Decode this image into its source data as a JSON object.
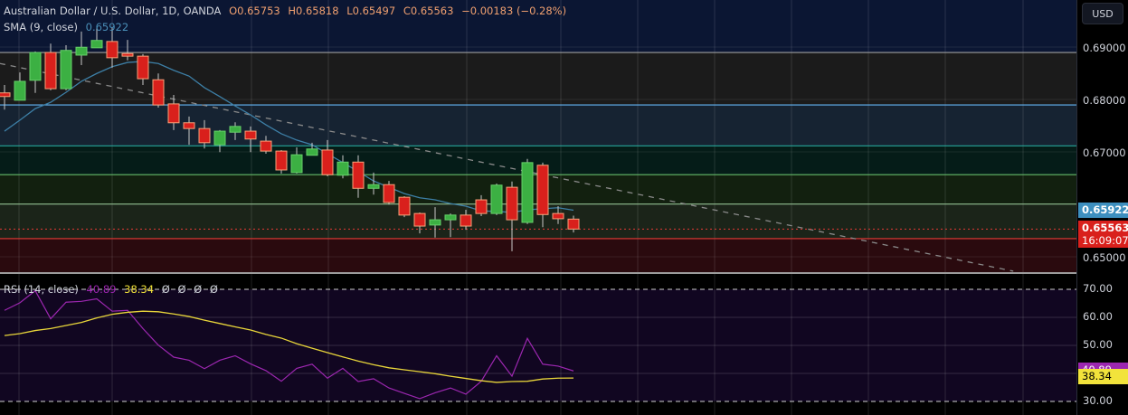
{
  "header": {
    "symbol_title": "Australian Dollar / U.S. Dollar, 1D, OANDA",
    "open": "O0.65753",
    "high": "H0.65818",
    "low": "L0.65497",
    "close": "C0.65563",
    "change": "−0.00183 (−0.28%)",
    "sma_label": "SMA (9, close)",
    "sma_value": "0.65922",
    "rsi_label": "RSI (14, close)",
    "rsi_value": "40.89",
    "rsi_ma_value": "38.34",
    "rsi_empty": [
      "Ø",
      "Ø",
      "Ø",
      "Ø"
    ]
  },
  "price_axis": {
    "currency_button": "USD",
    "ticks": [
      {
        "label": "0.69000",
        "v": 0.69
      },
      {
        "label": "0.68000",
        "v": 0.68
      },
      {
        "label": "0.67000",
        "v": 0.67
      },
      {
        "label": "0.65000",
        "v": 0.65
      }
    ],
    "sma_badge": {
      "label": "0.65922",
      "v": 0.65922
    },
    "price_badge": {
      "label": "0.65563",
      "countdown": "16:09:07",
      "v": 0.65563
    }
  },
  "rsi_axis": {
    "ticks": [
      {
        "label": "70.00",
        "v": 70
      },
      {
        "label": "60.00",
        "v": 60
      },
      {
        "label": "50.00",
        "v": 50
      },
      {
        "label": "30.00",
        "v": 30
      }
    ],
    "rsi_badge": {
      "label": "40.89",
      "v": 40.89
    },
    "ma_badge": {
      "label": "38.34",
      "v": 38.34
    }
  },
  "colors": {
    "up": "#3cb043",
    "down": "#d9201c",
    "down_border": "#f7a27a",
    "up_border": "#66d06a",
    "sma": "#3d7fa6",
    "rsi": "#9c27b0",
    "rsi_ma": "#f2e33b",
    "sma_badge": "#3d8fbf",
    "price_badge": "#d9201c"
  },
  "chart_data": {
    "type": "candlestick",
    "candles": [
      [
        0.6816,
        0.6831,
        0.6784,
        0.6809
      ],
      [
        0.6802,
        0.6855,
        0.6802,
        0.6838
      ],
      [
        0.684,
        0.6895,
        0.6816,
        0.6893
      ],
      [
        0.6893,
        0.691,
        0.6821,
        0.6824
      ],
      [
        0.6824,
        0.6907,
        0.6821,
        0.6897
      ],
      [
        0.6888,
        0.6933,
        0.6869,
        0.6903
      ],
      [
        0.6902,
        0.6941,
        0.6902,
        0.6916
      ],
      [
        0.6914,
        0.6941,
        0.6864,
        0.6883
      ],
      [
        0.6891,
        0.6917,
        0.6878,
        0.6886
      ],
      [
        0.6886,
        0.689,
        0.6831,
        0.6843
      ],
      [
        0.6841,
        0.6853,
        0.6788,
        0.6793
      ],
      [
        0.6795,
        0.6812,
        0.6745,
        0.6759
      ],
      [
        0.6759,
        0.6771,
        0.6717,
        0.6748
      ],
      [
        0.6748,
        0.6764,
        0.671,
        0.6721
      ],
      [
        0.6717,
        0.6745,
        0.6703,
        0.6743
      ],
      [
        0.6741,
        0.676,
        0.6726,
        0.6752
      ],
      [
        0.6743,
        0.6752,
        0.6703,
        0.6728
      ],
      [
        0.6724,
        0.6734,
        0.67,
        0.6705
      ],
      [
        0.6705,
        0.6707,
        0.6662,
        0.6669
      ],
      [
        0.6664,
        0.6712,
        0.6662,
        0.6698
      ],
      [
        0.6697,
        0.6721,
        0.6697,
        0.6709
      ],
      [
        0.6707,
        0.6726,
        0.6657,
        0.666
      ],
      [
        0.6659,
        0.6697,
        0.6653,
        0.6684
      ],
      [
        0.6684,
        0.6697,
        0.6616,
        0.6634
      ],
      [
        0.6634,
        0.6664,
        0.6622,
        0.6641
      ],
      [
        0.6641,
        0.6648,
        0.6603,
        0.6607
      ],
      [
        0.6617,
        0.6619,
        0.6579,
        0.6583
      ],
      [
        0.6586,
        0.6588,
        0.6548,
        0.6562
      ],
      [
        0.6564,
        0.6598,
        0.654,
        0.6574
      ],
      [
        0.6574,
        0.6586,
        0.6541,
        0.6583
      ],
      [
        0.6583,
        0.6593,
        0.6555,
        0.6562
      ],
      [
        0.6612,
        0.6621,
        0.6581,
        0.6586
      ],
      [
        0.6586,
        0.6643,
        0.6583,
        0.664
      ],
      [
        0.6636,
        0.6647,
        0.6514,
        0.6574
      ],
      [
        0.6569,
        0.669,
        0.6566,
        0.6683
      ],
      [
        0.6678,
        0.6683,
        0.656,
        0.6584
      ],
      [
        0.6586,
        0.66,
        0.6566,
        0.6576
      ],
      [
        0.65753,
        0.65818,
        0.65497,
        0.65563
      ]
    ],
    "candle_fields": [
      "open",
      "high",
      "low",
      "close"
    ],
    "sma9": [
      0.6743,
      0.6764,
      0.6786,
      0.6798,
      0.6817,
      0.6838,
      0.6853,
      0.6866,
      0.6874,
      0.6876,
      0.6872,
      0.6859,
      0.6848,
      0.6826,
      0.6809,
      0.6791,
      0.6774,
      0.6755,
      0.6738,
      0.6726,
      0.6717,
      0.67,
      0.6683,
      0.6666,
      0.6648,
      0.6636,
      0.6624,
      0.6616,
      0.6612,
      0.6605,
      0.66,
      0.6591,
      0.659,
      0.6588,
      0.6593,
      0.6595,
      0.6597,
      0.65922
    ],
    "levels": [
      {
        "v": 0.6893,
        "color": "#9e9e9e",
        "fill": "#1b1b1b"
      },
      {
        "v": 0.6793,
        "color": "#64b5f6",
        "fill": "#162332"
      },
      {
        "v": 0.6715,
        "color": "#26a69a",
        "fill": "#051c18"
      },
      {
        "v": 0.666,
        "color": "#66bb6a",
        "fill": "#12200f"
      },
      {
        "v": 0.6604,
        "color": "#8fbc8f",
        "fill": "#1b2419"
      },
      {
        "v": 0.6538,
        "color": "#e53935",
        "fill": "#2a0a0e"
      }
    ],
    "trendline": [
      {
        "i": -0.3,
        "v": 0.6872
      },
      {
        "i": 65.6,
        "v": 0.6476
      }
    ],
    "rsi": [
      62.5,
      65.2,
      69.5,
      59.5,
      65.4,
      65.7,
      66.6,
      62.2,
      62.5,
      56.0,
      50.1,
      45.8,
      44.7,
      41.7,
      44.7,
      46.3,
      43.4,
      41.0,
      37.2,
      41.8,
      43.3,
      38.3,
      41.8,
      37.1,
      38.1,
      34.8,
      32.9,
      31.0,
      33.1,
      34.8,
      32.6,
      37.2,
      46.3,
      39.0,
      52.5,
      43.3,
      42.6,
      40.89
    ],
    "rsi_ma": [
      53.5,
      54.2,
      55.3,
      56.0,
      57.1,
      58.2,
      59.8,
      61.1,
      61.8,
      62.2,
      62.0,
      61.2,
      60.3,
      59.0,
      57.8,
      56.6,
      55.5,
      53.9,
      52.6,
      50.6,
      49.0,
      47.4,
      45.9,
      44.4,
      43.1,
      42.0,
      41.3,
      40.6,
      39.9,
      39.0,
      38.2,
      37.4,
      36.8,
      37.1,
      37.2,
      38.0,
      38.3,
      38.34
    ],
    "price_range": [
      0.6462,
      0.6993
    ],
    "rsi_range": [
      25.5,
      79.7
    ]
  }
}
